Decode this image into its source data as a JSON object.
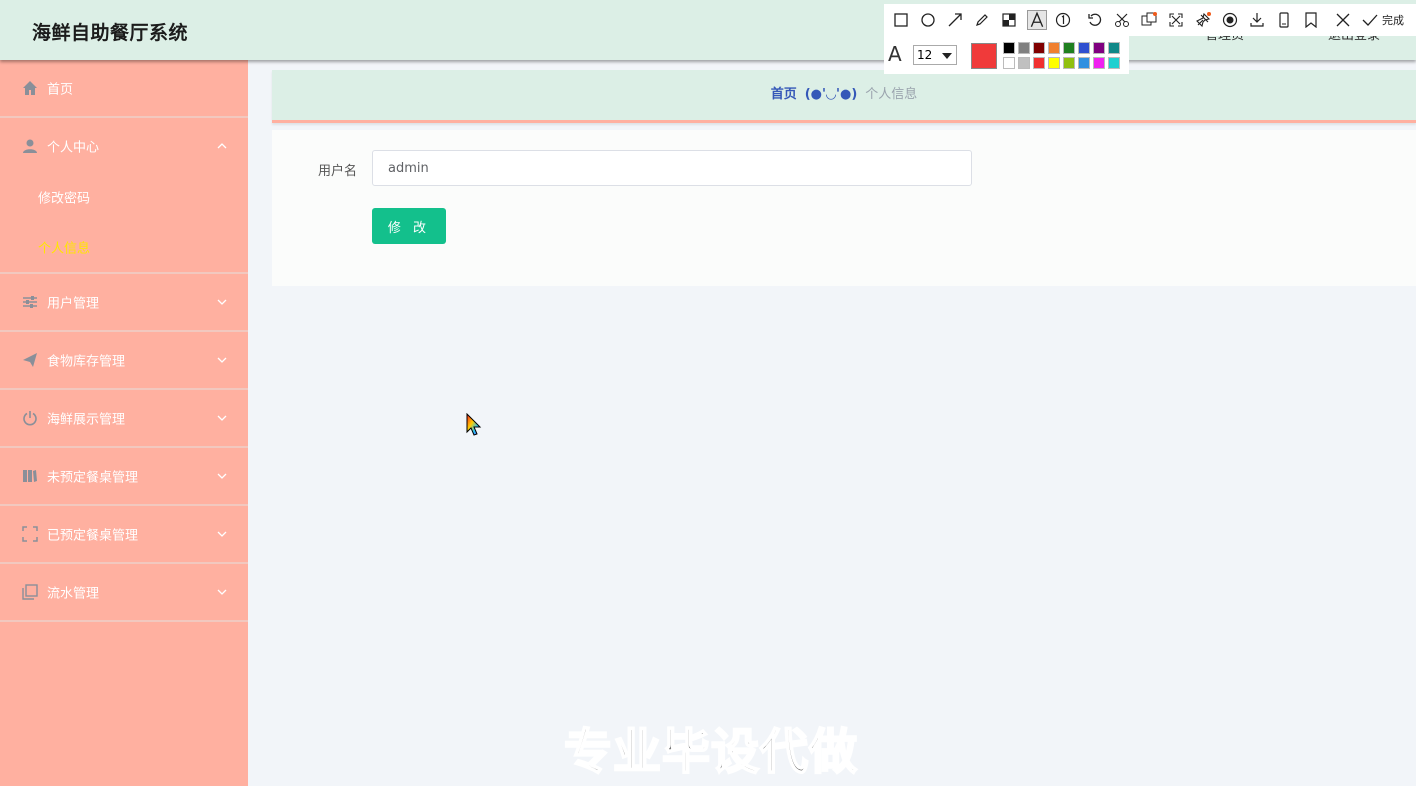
{
  "header": {
    "app_title": "海鲜自助餐厅系统",
    "right_user": "管理员",
    "right_logout": "退出登录"
  },
  "sidebar": {
    "items": [
      {
        "label": "首页",
        "icon": "home-icon"
      },
      {
        "label": "个人中心",
        "icon": "user-icon",
        "expanded": true,
        "children": [
          {
            "label": "修改密码"
          },
          {
            "label": "个人信息",
            "active": true
          }
        ]
      },
      {
        "label": "用户管理",
        "icon": "sliders-icon"
      },
      {
        "label": "食物库存管理",
        "icon": "send-icon"
      },
      {
        "label": "海鲜展示管理",
        "icon": "power-icon"
      },
      {
        "label": "未预定餐桌管理",
        "icon": "book-icon"
      },
      {
        "label": "已预定餐桌管理",
        "icon": "fullscreen-icon"
      },
      {
        "label": "流水管理",
        "icon": "copy-icon"
      }
    ]
  },
  "breadcrumb": {
    "home": "首页",
    "separator": "(●'◡'●)",
    "current": "个人信息"
  },
  "form": {
    "username_label": "用户名",
    "username_value": "admin",
    "submit_label": "修 改"
  },
  "screenshot_tool": {
    "font_size": "12",
    "done_label": "完成",
    "current_color": "#f03a3a",
    "palette": [
      "#000000",
      "#808080",
      "#800000",
      "#f08030",
      "#208020",
      "#3050d0",
      "#800080",
      "#108888",
      "#ffffff",
      "#c0c0c0",
      "#f03030",
      "#ffff00",
      "#90c010",
      "#3090e0",
      "#f020f0",
      "#20d0d0"
    ]
  },
  "watermark": "专业毕设代做",
  "colors": {
    "sidebar_bg": "#ffb0a0",
    "header_bg": "#dcefe6",
    "active_sub": "#ffe600",
    "button": "#13c08c"
  }
}
